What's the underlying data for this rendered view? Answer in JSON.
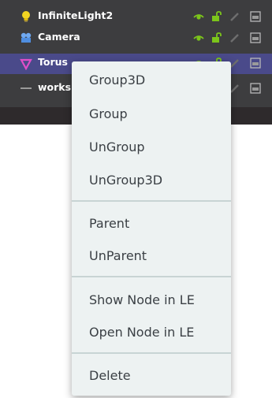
{
  "scene_tree": {
    "rows": [
      {
        "label": "InfiniteLight2",
        "icon": "lightbulb-icon"
      },
      {
        "label": "Camera",
        "icon": "camera-icon"
      },
      {
        "label": "Torus",
        "icon": "triangle-down-icon"
      },
      {
        "label": "works",
        "icon": "dash-icon"
      }
    ],
    "row_controls": [
      "eye-icon",
      "unlock-icon",
      "pencil-icon",
      "layer-icon"
    ]
  },
  "context_menu": {
    "groups": [
      [
        "Group3D",
        "Group",
        "UnGroup",
        "UnGroup3D"
      ],
      [
        "Parent",
        "UnParent"
      ],
      [
        "Show Node in LE",
        "Open Node in LE"
      ],
      [
        "Delete"
      ]
    ]
  },
  "colors": {
    "panel_bg": "#3d3d3f",
    "selected_row": "#4a4a8a",
    "menu_bg": "#edf2f2",
    "menu_text": "#3a3f44",
    "separator": "#c8d4d4",
    "control_green": "#7cc51b"
  }
}
